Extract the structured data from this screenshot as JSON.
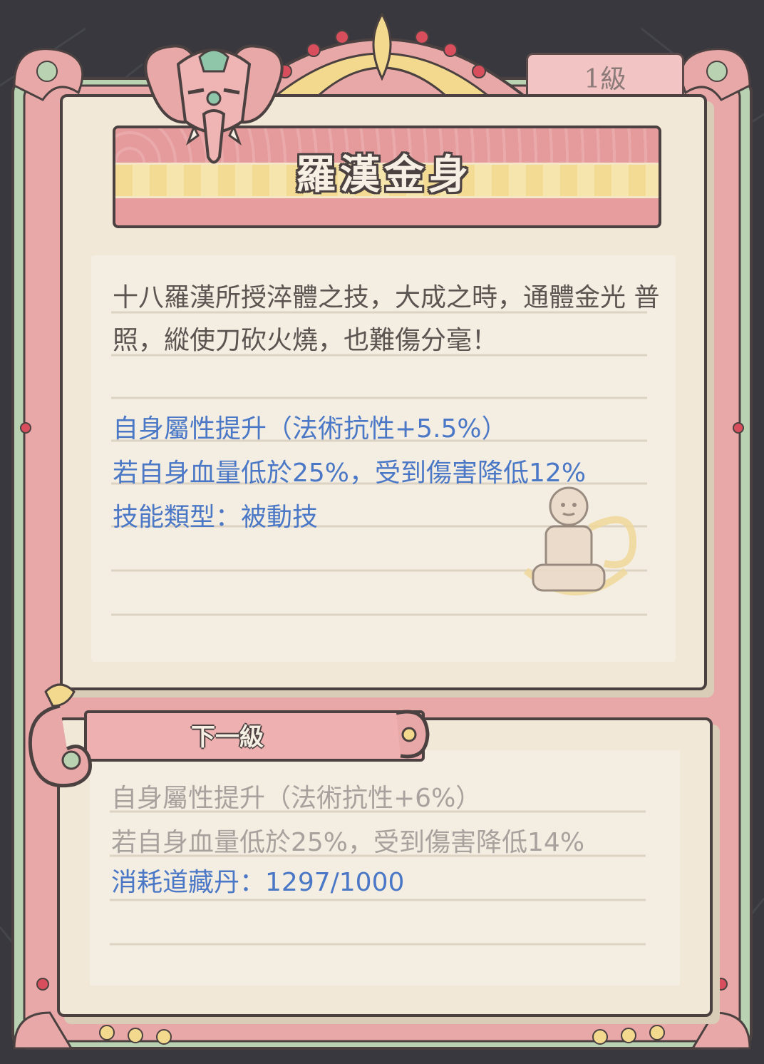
{
  "skill": {
    "level": "1級",
    "name": "羅漢金身",
    "description": "十八羅漢所授淬體之技，大成之時，通體金光 普照，縱使刀砍火燒，也難傷分毫！",
    "stats": [
      "自身屬性提升（法術抗性+5.5%）",
      "若自身血量低於25%，受到傷害降低12%",
      "技能類型：被動技"
    ]
  },
  "next_level": {
    "label": "下一級",
    "stats": [
      "自身屬性提升（法術抗性+6%）",
      "若自身血量低於25%，受到傷害降低14%"
    ],
    "cost_label": "消耗道藏丹：",
    "cost_value": "1297/1000"
  },
  "colors": {
    "stat_blue": "#4a78c6",
    "next_gray": "#a8a29e",
    "frame_pink": "#e9a8a8",
    "frame_green": "#b9d3b2",
    "paper": "#f1e8d8"
  },
  "icons": [
    "elephant-head-icon",
    "meditating-monk-icon",
    "lotus-ornament-icon"
  ]
}
